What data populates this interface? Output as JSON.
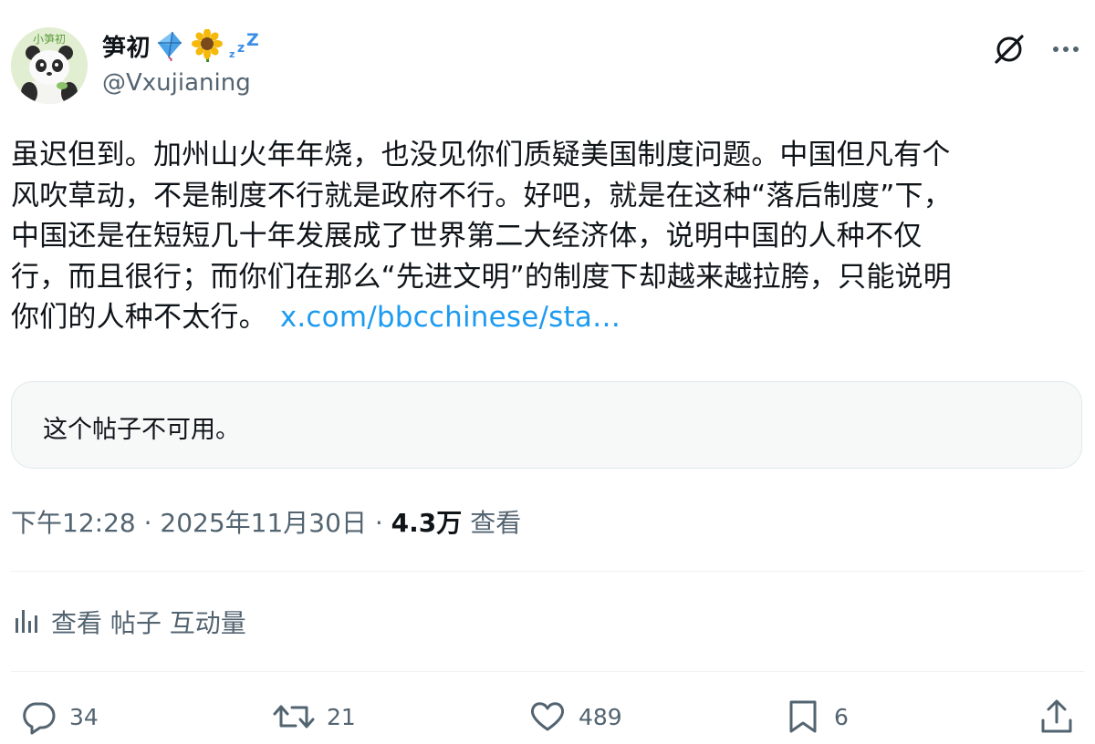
{
  "author": {
    "display_name": "笋初",
    "handle": "@Vxujianing",
    "avatar_text": "小笋初"
  },
  "tweet": {
    "lines": [
      "虽迟但到。加州山火年年烧，也没见你们质疑美国制度问题。中国但凡有个",
      "风吹草动，不是制度不行就是政府不行。好吧，就是在这种“落后制度”下，",
      "中国还是在短短几十年发展成了世界第二大经济体，说明中国的人种不仅",
      "行，而且很行；而你们在那么“先进文明”的制度下却越来越拉胯，只能说明",
      "你们的人种不太行。"
    ],
    "link_text": "x.com/bbcchinese/sta…",
    "quoted_unavailable": "这个帖子不可用。"
  },
  "meta": {
    "time": "下午12:28",
    "date": "2025年11月30日",
    "views_count": "4.3万",
    "views_label": "查看",
    "separator": "·"
  },
  "engagements_label": "查看 帖子 互动量",
  "actions": {
    "replies": "34",
    "reposts": "21",
    "likes": "489",
    "bookmarks": "6"
  },
  "icons": [
    "kite-icon",
    "sunflower-icon",
    "zzz-icon",
    "grok-icon",
    "more-icon",
    "analytics-icon",
    "reply-icon",
    "repost-icon",
    "like-icon",
    "bookmark-icon",
    "share-icon"
  ],
  "colors": {
    "link": "#1d9bf0",
    "secondary_text": "#536471",
    "text": "#0f1419"
  }
}
